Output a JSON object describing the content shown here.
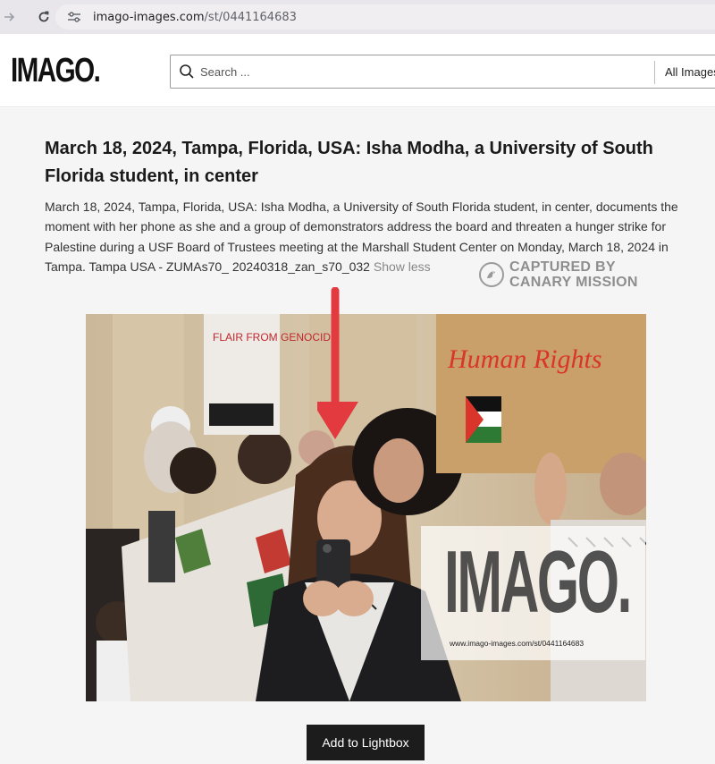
{
  "browser": {
    "url_host": "imago-images.com",
    "url_path": "/st/0441164683"
  },
  "header": {
    "logo": "IMAGO.",
    "search_placeholder": "Search ...",
    "search_scope": "All Images"
  },
  "main": {
    "title": "March 18, 2024, Tampa, Florida, USA: Isha Modha, a University of South Florida student, in center",
    "description": "March 18, 2024, Tampa, Florida, USA: Isha Modha, a University of South Florida student, in center, documents the moment with her phone as she and a group of demonstrators address the board and threaten a hunger strike for Palestine during a USF Board of Trustees meeting at the Marshall Student Center on Monday, March 18, 2024 in Tampa. Tampa USA - ZUMAs70_ 20240318_zan_s70_032",
    "show_less": "Show less",
    "watermark_line1": "CAPTURED BY",
    "watermark_line2": "CANARY MISSION",
    "add_to_lightbox": "Add to Lightbox"
  },
  "photo": {
    "sign_top_left": "FLAIR FROM GENOCIDE",
    "sign_human_rights": "Human Rights",
    "overlay_logo": "IMAGO.",
    "overlay_url": "www.imago-images.com/st/0441164683"
  }
}
